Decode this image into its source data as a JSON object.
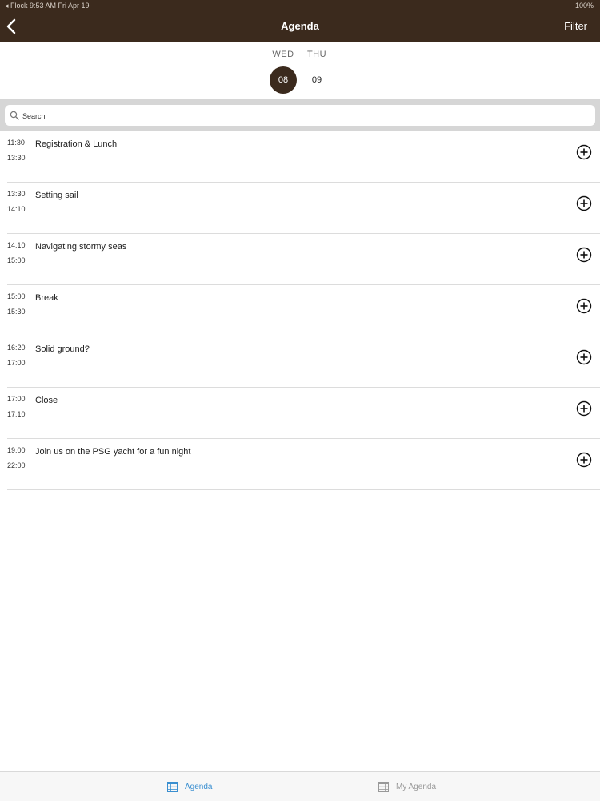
{
  "status_bar": {
    "left": "◂ Flock   9:53 AM   Fri Apr 19",
    "right": "100%"
  },
  "header": {
    "title": "Agenda",
    "filter_label": "Filter",
    "background": "#3b2a1d"
  },
  "days": [
    {
      "name": "WED",
      "number": "08",
      "selected": true
    },
    {
      "name": "THU",
      "number": "09",
      "selected": false
    }
  ],
  "search": {
    "placeholder": "Search",
    "value": ""
  },
  "sessions": [
    {
      "start": "11:30",
      "end": "13:30",
      "title": "Registration & Lunch"
    },
    {
      "start": "13:30",
      "end": "14:10",
      "title": "Setting sail"
    },
    {
      "start": "14:10",
      "end": "15:00",
      "title": "Navigating stormy seas"
    },
    {
      "start": "15:00",
      "end": "15:30",
      "title": "Break"
    },
    {
      "start": "16:20",
      "end": "17:00",
      "title": "Solid ground?"
    },
    {
      "start": "17:00",
      "end": "17:10",
      "title": "Close"
    },
    {
      "start": "19:00",
      "end": "22:00",
      "title": "Join us on the PSG yacht for a fun night"
    }
  ],
  "tabs": [
    {
      "label": "Agenda",
      "icon": "calendar-icon",
      "active": true
    },
    {
      "label": "My Agenda",
      "icon": "calendar-icon",
      "active": false
    }
  ],
  "colors": {
    "accent": "#3a8fd0",
    "inactive": "#999999",
    "selected_day": "#3b2a1d"
  }
}
